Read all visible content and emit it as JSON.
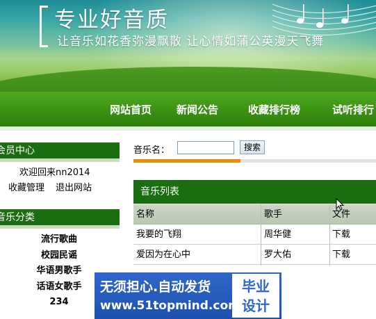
{
  "banner": {
    "title": "专业好音质",
    "slogan": "让音乐如花香弥漫飘散  让心情如蒲公英漫天飞舞"
  },
  "nav": {
    "items": [
      "网站首页",
      "新闻公告",
      "收藏排行榜",
      "试听排行"
    ]
  },
  "member": {
    "heading": "会员中心",
    "welcome": "欢迎回来nn2014",
    "links": [
      "收藏管理",
      "退出网站"
    ]
  },
  "categories": {
    "heading": "音乐分类",
    "items": [
      "流行歌曲",
      "校园民谣",
      "华语男歌手",
      "话语女歌手",
      "234"
    ]
  },
  "search": {
    "label": "音乐名：",
    "value": "",
    "button": "搜索",
    "progress_fraction": 0.44
  },
  "music_list": {
    "heading": "音乐列表",
    "columns": [
      "名称",
      "歌手",
      "文件"
    ],
    "rows": [
      [
        "我要的飞翔",
        "周华健",
        "下载"
      ],
      [
        "爱因为在心中",
        "罗大佑",
        "下载"
      ]
    ]
  },
  "ad": {
    "line1": "无须担心.自动发货",
    "line2": "www.51topmind.com",
    "badge": [
      "毕业",
      "设计"
    ]
  },
  "colors": {
    "nav_green": "#3d9414",
    "panel_green": "#1b6e10",
    "progress_orange": "#f08a00",
    "ad_blue": "#2f67c9"
  }
}
